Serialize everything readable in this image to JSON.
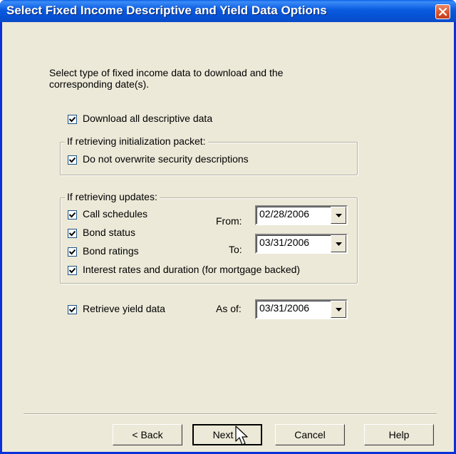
{
  "window": {
    "title": "Select Fixed Income Descriptive and Yield Data Options"
  },
  "intro_text": "Select type of fixed income data to download and the corresponding date(s).",
  "download_all": {
    "label": "Download all descriptive data",
    "checked": true
  },
  "init_group": {
    "label": "If retrieving initialization packet:",
    "do_not_overwrite": {
      "label": "Do not overwrite security descriptions",
      "checked": true
    }
  },
  "updates_group": {
    "label": "If retrieving updates:",
    "items": [
      {
        "label": "Call schedules",
        "checked": true
      },
      {
        "label": "Bond status",
        "checked": true
      },
      {
        "label": "Bond ratings",
        "checked": true
      },
      {
        "label": "Interest rates and duration (for mortgage backed)",
        "checked": true
      }
    ],
    "from_label": "From:",
    "from_value": "02/28/2006",
    "to_label": "To:",
    "to_value": "03/31/2006"
  },
  "yield": {
    "label": "Retrieve yield data",
    "checked": true,
    "as_of_label": "As of:",
    "as_of_value": "03/31/2006"
  },
  "buttons": {
    "back": "< Back",
    "next": "Next >",
    "cancel": "Cancel",
    "help": "Help"
  },
  "icons": {
    "close": "close-icon",
    "checkmark": "checkmark-icon",
    "dropdown": "dropdown-arrow-icon",
    "cursor": "mouse-pointer-icon"
  },
  "colors": {
    "title_bar": "#0a5ae0",
    "dialog_bg": "#ece9d8",
    "close_button": "#d9542c"
  }
}
